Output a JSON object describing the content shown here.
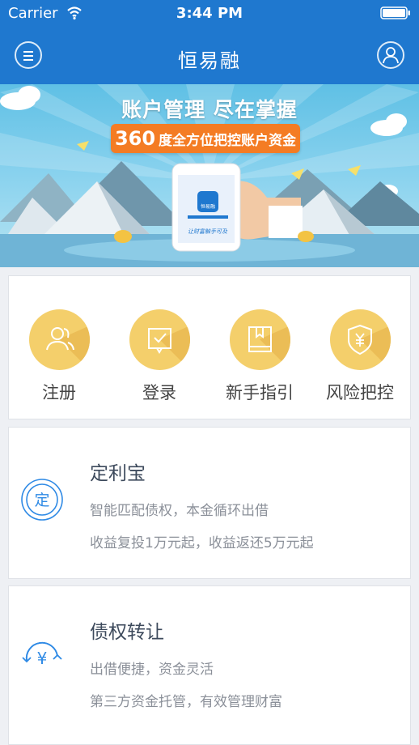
{
  "status_bar": {
    "carrier": "Carrier",
    "time": "3:44 PM"
  },
  "nav": {
    "brand": "恒易融",
    "menu_icon": "hamburger-menu-icon",
    "user_icon": "user-profile-icon"
  },
  "banner": {
    "title": "账户管理 尽在掌握",
    "pill_number": "360",
    "pill_text": "度全方位把控账户资金",
    "phone_app_name": "恒易融",
    "phone_caption": "让财富触手可及"
  },
  "quick_actions": [
    {
      "label": "注册",
      "icon": "users-icon"
    },
    {
      "label": "登录",
      "icon": "login-check-icon"
    },
    {
      "label": "新手指引",
      "icon": "book-icon"
    },
    {
      "label": "风险把控",
      "icon": "shield-yen-icon"
    }
  ],
  "products": [
    {
      "title": "定利宝",
      "line1": "智能匹配债权，本金循环出借",
      "line2": "收益复投1万元起，收益返还5万元起",
      "icon": "ding-badge-icon",
      "icon_text": "定"
    },
    {
      "title": "债权转让",
      "line1": "出借便捷，资金灵活",
      "line2": "第三方资金托管，有效管理财富",
      "icon": "yen-transfer-icon",
      "icon_text": "¥"
    }
  ],
  "colors": {
    "nav_blue": "#1f78cf",
    "action_yellow": "#f4cf6b",
    "pill_orange": "#f47c24",
    "product_icon_blue": "#2f8ae5"
  }
}
